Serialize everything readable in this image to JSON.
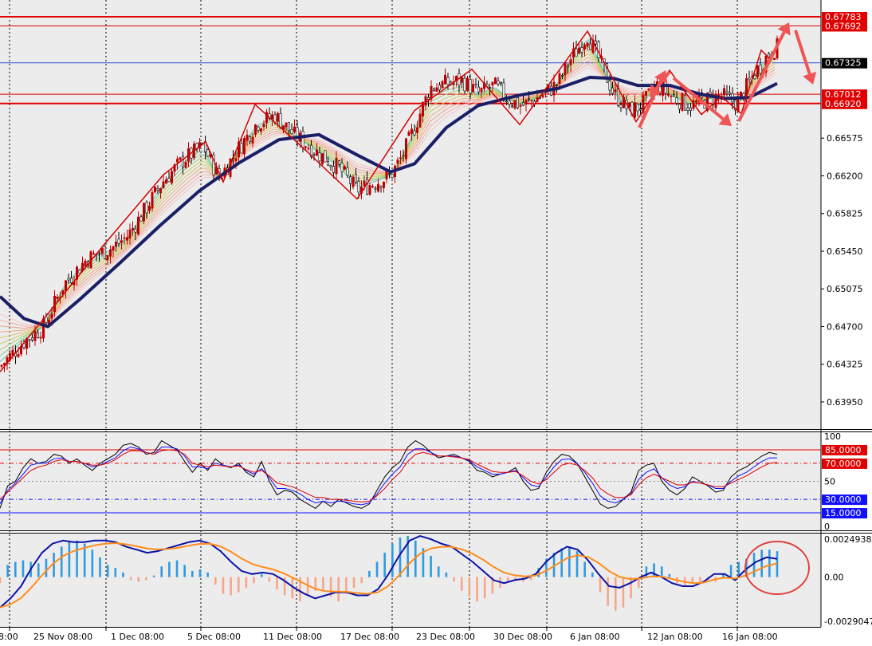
{
  "colors": {
    "background": "#ececec",
    "up_candle": "#c00000",
    "down_candle": "#000000",
    "resistance_line": "#e00000",
    "current_price_line": "#3355cc",
    "slow_ma": "#1a1f66",
    "zigzag": "#d00000",
    "arrow": "#f05555",
    "stoch_main": "#000000",
    "stoch_blue": "#1010ff",
    "stoch_red": "#e00000",
    "macd_pos_hist": "#2e9ae0",
    "macd_neg_hist": "#f6a688",
    "macd_line": "#0a12a8",
    "macd_signal": "#ff8c1a",
    "circle": "#e04040"
  },
  "chart_data": [
    {
      "type": "candlestick",
      "title": "",
      "x_labels": [
        "8:00",
        "25 Nov 08:00",
        "1 Dec 08:00",
        "5 Dec 08:00",
        "11 Dec 08:00",
        "17 Dec 08:00",
        "23 Dec 08:00",
        "30 Dec 08:00",
        "6 Jan 08:00",
        "12 Jan 08:00",
        "16 Jan 08:00"
      ],
      "y_ticks": [
        "0.66575",
        "0.66200",
        "0.65825",
        "0.65450",
        "0.65075",
        "0.64700",
        "0.64325",
        "0.63950"
      ],
      "ylim": [
        0.6368,
        0.6795
      ],
      "zigzag_points": [
        [
          0,
          0.6425
        ],
        [
          50,
          0.6473
        ],
        [
          130,
          0.6551
        ],
        [
          205,
          0.6621
        ],
        [
          258,
          0.6654
        ],
        [
          280,
          0.6614
        ],
        [
          320,
          0.6691
        ],
        [
          380,
          0.6648
        ],
        [
          448,
          0.6597
        ],
        [
          520,
          0.6685
        ],
        [
          592,
          0.6726
        ],
        [
          652,
          0.6671
        ],
        [
          737,
          0.6764
        ],
        [
          798,
          0.6674
        ],
        [
          840,
          0.6725
        ],
        [
          880,
          0.6681
        ],
        [
          905,
          0.6699
        ],
        [
          930,
          0.6682
        ],
        [
          955,
          0.6745
        ],
        [
          968,
          0.6735
        ]
      ],
      "price_levels": [
        {
          "label": "0.67783",
          "value": 0.67783
        },
        {
          "label": "0.67692",
          "value": 0.67692
        },
        {
          "label": "0.67012",
          "value": 0.67012
        },
        {
          "label": "0.66920",
          "value": 0.6692
        }
      ],
      "current_price": {
        "label": "0.67325",
        "value": 0.67325
      },
      "slow_ma": [
        [
          0,
          0.65
        ],
        [
          30,
          0.6478
        ],
        [
          60,
          0.647
        ],
        [
          100,
          0.6497
        ],
        [
          150,
          0.6533
        ],
        [
          200,
          0.657
        ],
        [
          250,
          0.6605
        ],
        [
          300,
          0.6633
        ],
        [
          350,
          0.6656
        ],
        [
          400,
          0.6661
        ],
        [
          450,
          0.664
        ],
        [
          490,
          0.6624
        ],
        [
          520,
          0.6632
        ],
        [
          560,
          0.6668
        ],
        [
          600,
          0.669
        ],
        [
          650,
          0.67
        ],
        [
          700,
          0.6707
        ],
        [
          740,
          0.6718
        ],
        [
          770,
          0.6717
        ],
        [
          800,
          0.671
        ],
        [
          840,
          0.671
        ],
        [
          880,
          0.6701
        ],
        [
          910,
          0.6697
        ],
        [
          940,
          0.6698
        ],
        [
          975,
          0.6712
        ]
      ],
      "price_path": [
        [
          0,
          0.643
        ],
        [
          30,
          0.6455
        ],
        [
          55,
          0.647
        ],
        [
          80,
          0.6512
        ],
        [
          110,
          0.6538
        ],
        [
          140,
          0.6548
        ],
        [
          160,
          0.656
        ],
        [
          185,
          0.659
        ],
        [
          205,
          0.6615
        ],
        [
          230,
          0.6636
        ],
        [
          255,
          0.665
        ],
        [
          275,
          0.6618
        ],
        [
          300,
          0.6648
        ],
        [
          322,
          0.6672
        ],
        [
          345,
          0.668
        ],
        [
          370,
          0.666
        ],
        [
          400,
          0.6642
        ],
        [
          425,
          0.6628
        ],
        [
          448,
          0.6606
        ],
        [
          470,
          0.6613
        ],
        [
          490,
          0.662
        ],
        [
          505,
          0.664
        ],
        [
          520,
          0.6668
        ],
        [
          540,
          0.6708
        ],
        [
          560,
          0.6712
        ],
        [
          580,
          0.6715
        ],
        [
          600,
          0.6702
        ],
        [
          620,
          0.671
        ],
        [
          640,
          0.6695
        ],
        [
          655,
          0.669
        ],
        [
          680,
          0.67
        ],
        [
          700,
          0.6712
        ],
        [
          715,
          0.6735
        ],
        [
          737,
          0.676
        ],
        [
          752,
          0.6735
        ],
        [
          770,
          0.6702
        ],
        [
          790,
          0.6685
        ],
        [
          805,
          0.669
        ],
        [
          825,
          0.671
        ],
        [
          845,
          0.6698
        ],
        [
          865,
          0.669
        ],
        [
          885,
          0.6695
        ],
        [
          905,
          0.67
        ],
        [
          925,
          0.6692
        ],
        [
          945,
          0.672
        ],
        [
          965,
          0.6742
        ],
        [
          975,
          0.6748
        ]
      ],
      "arrows_label": ""
    },
    {
      "type": "line",
      "indicator": "stochastic",
      "y_ticks": [
        "100",
        "85.0000",
        "70.0000",
        "50",
        "30.0000",
        "15.0000",
        "0"
      ],
      "levels": [
        85,
        70,
        50,
        30,
        15
      ],
      "ylim": [
        0,
        100
      ],
      "series": [
        {
          "values": [
            20,
            45,
            50,
            65,
            75,
            70,
            72,
            80,
            78,
            70,
            75,
            68,
            62,
            70,
            75,
            80,
            90,
            92,
            88,
            80,
            82,
            95,
            90,
            85,
            72,
            60,
            70,
            62,
            75,
            68,
            65,
            70,
            60,
            55,
            72,
            50,
            35,
            40,
            38,
            30,
            25,
            20,
            28,
            22,
            30,
            26,
            22,
            20,
            25,
            40,
            55,
            65,
            72,
            88,
            95,
            90,
            82,
            76,
            78,
            80,
            76,
            72,
            62,
            60,
            55,
            58,
            60,
            65,
            50,
            40,
            42,
            60,
            72,
            80,
            78,
            70,
            55,
            40,
            25,
            20,
            22,
            30,
            38,
            62,
            68,
            70,
            50,
            40,
            35,
            42,
            55,
            50,
            45,
            38,
            40,
            55,
            62,
            66,
            72,
            78,
            82,
            80
          ]
        },
        {
          "values": [
            25,
            40,
            48,
            58,
            68,
            70,
            70,
            75,
            76,
            72,
            72,
            70,
            66,
            68,
            72,
            76,
            84,
            88,
            86,
            82,
            80,
            88,
            88,
            86,
            78,
            66,
            66,
            64,
            70,
            68,
            66,
            68,
            62,
            58,
            64,
            54,
            42,
            42,
            40,
            36,
            30,
            26,
            28,
            26,
            28,
            27,
            25,
            24,
            26,
            36,
            48,
            58,
            66,
            80,
            86,
            86,
            82,
            78,
            78,
            78,
            76,
            73,
            66,
            62,
            58,
            58,
            60,
            62,
            54,
            46,
            44,
            55,
            66,
            74,
            75,
            70,
            60,
            48,
            34,
            28,
            26,
            30,
            36,
            52,
            60,
            64,
            54,
            46,
            42,
            44,
            50,
            48,
            46,
            42,
            42,
            50,
            56,
            60,
            66,
            72,
            76,
            76
          ]
        },
        {
          "values": [
            30,
            38,
            46,
            54,
            62,
            66,
            68,
            72,
            74,
            72,
            72,
            70,
            68,
            68,
            70,
            74,
            80,
            84,
            84,
            82,
            80,
            84,
            85,
            84,
            80,
            70,
            68,
            66,
            68,
            67,
            66,
            67,
            63,
            60,
            62,
            56,
            48,
            46,
            44,
            40,
            36,
            32,
            32,
            30,
            30,
            29,
            28,
            27,
            28,
            34,
            42,
            52,
            60,
            72,
            80,
            82,
            80,
            78,
            78,
            77,
            76,
            74,
            69,
            65,
            61,
            60,
            60,
            61,
            56,
            50,
            47,
            52,
            60,
            68,
            70,
            68,
            62,
            54,
            42,
            36,
            32,
            32,
            35,
            46,
            54,
            58,
            54,
            50,
            46,
            46,
            49,
            48,
            46,
            44,
            44,
            48,
            52,
            56,
            61,
            66,
            70,
            71
          ]
        }
      ]
    },
    {
      "type": "bar",
      "indicator": "macd",
      "y_ticks": [
        "0.0024938",
        "0.00",
        "-0.0029047"
      ],
      "ylim": [
        -0.0029047,
        0.0024938
      ],
      "histogram": [
        -0.0004,
        0.0008,
        0.001,
        0.0011,
        0.001,
        0.0009,
        0.0012,
        0.0016,
        0.002,
        0.0023,
        0.0024,
        0.0022,
        0.0018,
        0.0013,
        0.0008,
        0.0006,
        0.0003,
        -0.0002,
        -0.0003,
        -0.0002,
        0.0001,
        0.0007,
        0.001,
        0.0011,
        0.0008,
        0.0004,
        0.0005,
        0.0003,
        -0.0005,
        -0.0011,
        -0.0012,
        -0.001,
        -0.0007,
        -0.0004,
        0.0002,
        -0.0003,
        -0.0008,
        -0.0012,
        -0.0014,
        -0.0016,
        -0.0012,
        -0.0009,
        -0.0008,
        -0.0013,
        -0.0016,
        -0.0011,
        -0.0007,
        -0.0004,
        0.0004,
        0.001,
        0.0016,
        0.0022,
        0.0026,
        0.0027,
        0.0024,
        0.0019,
        0.0014,
        0.0007,
        0.0003,
        -0.0003,
        -0.0009,
        -0.0013,
        -0.0016,
        -0.0014,
        -0.0011,
        -0.0007,
        -0.0003,
        -0.0002,
        -0.0003,
        -0.0002,
        0.0006,
        0.0012,
        0.0016,
        0.0019,
        0.002,
        0.0017,
        0.001,
        0.0003,
        -0.001,
        -0.0019,
        -0.0022,
        -0.002,
        -0.0014,
        -0.0007,
        0.0007,
        0.0009,
        0.0007,
        0.0002,
        -0.0004,
        -0.0006,
        -0.0004,
        -0.0003,
        -0.0002,
        -0.0003,
        0.0002,
        0.0008,
        0.001,
        0.0012,
        0.0016,
        0.0018,
        0.0018,
        0.0017
      ],
      "macd_line": [
        -0.002,
        -0.0014,
        -0.0006,
        0.0006,
        0.0016,
        0.0022,
        0.0024,
        0.0023,
        0.0023,
        0.0024,
        0.0024,
        0.0023,
        0.002,
        0.0018,
        0.0016,
        0.0017,
        0.0019,
        0.0021,
        0.0023,
        0.0024,
        0.0022,
        0.0017,
        0.001,
        0.0004,
        0.0002,
        0.0003,
        0.0002,
        -0.0002,
        -0.0007,
        -0.0011,
        -0.0014,
        -0.0012,
        -0.001,
        -0.001,
        -0.0012,
        -0.0012,
        -0.0008,
        0.0002,
        0.0014,
        0.0024,
        0.0027,
        0.0025,
        0.0022,
        0.002,
        0.0015,
        0.001,
        0.0004,
        -0.0002,
        -0.0004,
        -0.0002,
        -0.0001,
        0.0002,
        0.001,
        0.0016,
        0.002,
        0.0018,
        0.0011,
        0.0002,
        -0.0006,
        -0.0007,
        -0.0004,
        0.0,
        0.0003,
        0.0,
        -0.0004,
        -0.0006,
        -0.0006,
        -0.0003,
        0.0002,
        0.0002,
        -0.0002,
        0.0005,
        0.001,
        0.0013,
        0.0012
      ]
    }
  ]
}
